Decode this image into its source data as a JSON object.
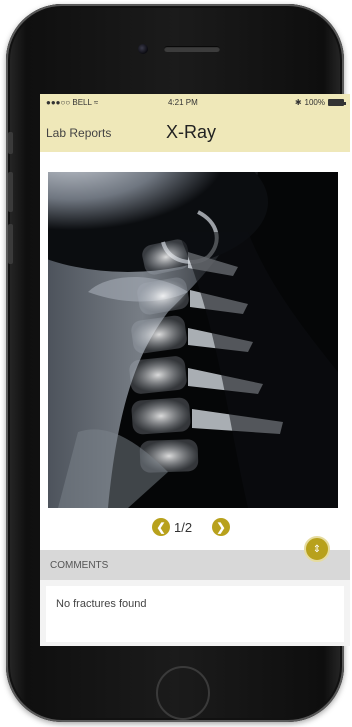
{
  "status_bar": {
    "carrier": "●●●○○ BELL ≈",
    "time": "4:21 PM",
    "battery": "100%"
  },
  "nav": {
    "back_label": "Lab Reports",
    "title": "X-Ray"
  },
  "pager": {
    "count_text": "1/2",
    "prev_icon": "chevron-left-icon",
    "next_icon": "chevron-right-icon"
  },
  "comments": {
    "header": "COMMENTS",
    "text": "No fractures found"
  },
  "colors": {
    "nav_bg": "#efe8b9",
    "accent": "#b8a11c",
    "comments_header_bg": "#d8d8d8"
  }
}
